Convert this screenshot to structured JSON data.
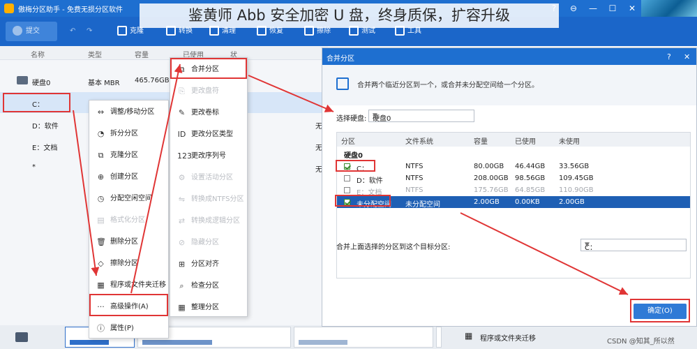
{
  "window": {
    "title": "傲梅分区助手 - 免费无损分区软件",
    "controls": [
      "?",
      "⊖",
      "—",
      "☐",
      "✕"
    ]
  },
  "banner": {
    "text": "鉴黄师 Abb 安全加密 U 盘，终身质保，扩容升级"
  },
  "toolbar": {
    "submit": "提交",
    "items": [
      "克隆",
      "转换",
      "清理",
      "恢复",
      "擦除",
      "测试",
      "工具"
    ]
  },
  "list": {
    "headers": [
      "名称",
      "类型",
      "容量",
      "已使用",
      "状"
    ],
    "disk": {
      "name": "硬盘0",
      "type": "基本 MBR",
      "size": "465.76GB"
    },
    "partitions": [
      {
        "name": "C："
      },
      {
        "name": "D：软件"
      },
      {
        "name": "E：文档"
      },
      {
        "name": "*"
      }
    ],
    "status": [
      "无",
      "无",
      "无"
    ]
  },
  "context_menu": {
    "items": [
      {
        "label": "调整/移动分区",
        "icon": "⇔",
        "enabled": true
      },
      {
        "label": "拆分分区",
        "icon": "◔",
        "enabled": true
      },
      {
        "label": "克隆分区",
        "icon": "⧉",
        "enabled": true
      },
      {
        "label": "创建分区",
        "icon": "⊕",
        "enabled": true
      },
      {
        "label": "分配空闲空间",
        "icon": "◷",
        "enabled": true
      },
      {
        "label": "格式化分区",
        "icon": "▤",
        "enabled": false
      },
      {
        "label": "删除分区",
        "icon": "🗑",
        "enabled": true
      },
      {
        "label": "擦除分区",
        "icon": "◇",
        "enabled": true
      },
      {
        "label": "程序或文件夹迁移",
        "icon": "▦",
        "enabled": true
      },
      {
        "label": "高级操作(A)",
        "icon": "···",
        "enabled": true
      },
      {
        "label": "属性(P)",
        "icon": "ⓘ",
        "enabled": true
      }
    ]
  },
  "submenu": {
    "items": [
      {
        "label": "合并分区",
        "icon": "⧉",
        "enabled": true
      },
      {
        "label": "更改盘符",
        "icon": "⎘",
        "enabled": false
      },
      {
        "label": "更改卷标",
        "icon": "✎",
        "enabled": true
      },
      {
        "label": "更改分区类型",
        "icon": "ID",
        "enabled": true
      },
      {
        "label": "更改序列号",
        "icon": "123",
        "enabled": true
      },
      {
        "label": "设置活动分区",
        "icon": "⚙",
        "enabled": false
      },
      {
        "label": "转换成NTFS分区",
        "icon": "⇋",
        "enabled": false
      },
      {
        "label": "转换成逻辑分区",
        "icon": "⇄",
        "enabled": false
      },
      {
        "label": "隐藏分区",
        "icon": "⊘",
        "enabled": false
      },
      {
        "label": "分区对齐",
        "icon": "⊞",
        "enabled": true
      },
      {
        "label": "检查分区",
        "icon": "⌕",
        "enabled": true
      },
      {
        "label": "整理分区",
        "icon": "▦",
        "enabled": true
      }
    ]
  },
  "dialog": {
    "title": "合并分区",
    "description": "合并两个临近分区到一个，或合并未分配空间给一个分区。",
    "select_disk_label": "选择硬盘:",
    "select_disk_value": "硬盘0",
    "table_headers": [
      "分区",
      "文件系统",
      "容量",
      "已使用",
      "未使用"
    ],
    "disk_group": "硬盘0",
    "rows": [
      {
        "name": "C：",
        "fs": "NTFS",
        "size": "80.00GB",
        "used": "46.44GB",
        "free": "33.56GB",
        "checked": true,
        "dim": false,
        "selected": false
      },
      {
        "name": "D：软件",
        "fs": "NTFS",
        "size": "208.00GB",
        "used": "98.56GB",
        "free": "109.45GB",
        "checked": false,
        "dim": false,
        "selected": false
      },
      {
        "name": "E：文档",
        "fs": "NTFS",
        "size": "175.76GB",
        "used": "64.85GB",
        "free": "110.90GB",
        "checked": false,
        "dim": true,
        "selected": false
      },
      {
        "name": "未分配空间",
        "fs": "未分配空间",
        "size": "2.00GB",
        "used": "0.00KB",
        "free": "2.00GB",
        "checked": true,
        "dim": false,
        "selected": true
      }
    ],
    "target_label": "合并上面选择的分区到这个目标分区:",
    "target_value": "C：",
    "ok": "确定(O)"
  },
  "bottom": {
    "migrate": "程序或文件夹迁移"
  },
  "watermark": "CSDN @知其_所以然"
}
